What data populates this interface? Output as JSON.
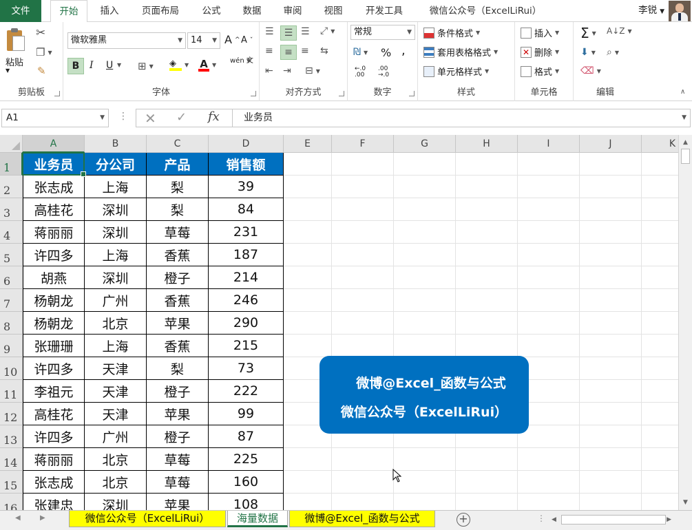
{
  "tabs": {
    "file": "文件",
    "items": [
      "开始",
      "插入",
      "页面布局",
      "公式",
      "数据",
      "审阅",
      "视图",
      "开发工具",
      "微信公众号（ExcelLiRui）"
    ],
    "active": "开始",
    "user": "李锐"
  },
  "ribbon": {
    "clipboard": {
      "paste": "粘贴",
      "label": "剪贴板"
    },
    "font": {
      "name": "微软雅黑",
      "size": "14",
      "bold": "B",
      "italic": "I",
      "underline": "U",
      "grow": "A",
      "shrink": "A",
      "phonetic": "wén 文",
      "label": "字体"
    },
    "alignment": {
      "label": "对齐方式"
    },
    "number": {
      "format": "常规",
      "percent": "%",
      "comma": ",",
      "inc_dec": ".00 .0",
      "label": "数字"
    },
    "styles": {
      "conditional": "条件格式",
      "table": "套用表格格式",
      "cell_styles": "单元格样式",
      "label": "样式"
    },
    "cells": {
      "insert": "插入",
      "delete": "删除",
      "format": "格式",
      "label": "单元格"
    },
    "editing": {
      "sum": "Σ",
      "label": "编辑"
    }
  },
  "formula_bar": {
    "name_box": "A1",
    "fx": "fx",
    "value": "业务员"
  },
  "columns": [
    "A",
    "B",
    "C",
    "D",
    "E",
    "F",
    "G",
    "H",
    "I",
    "J",
    "K"
  ],
  "rows": [
    "1",
    "2",
    "3",
    "4",
    "5",
    "6",
    "7",
    "8",
    "9",
    "10",
    "11",
    "12",
    "13",
    "14",
    "15",
    "16"
  ],
  "table": {
    "headers": [
      "业务员",
      "分公司",
      "产品",
      "销售额"
    ],
    "rows": [
      [
        "张志成",
        "上海",
        "梨",
        "39"
      ],
      [
        "高桂花",
        "深圳",
        "梨",
        "84"
      ],
      [
        "蒋丽丽",
        "深圳",
        "草莓",
        "231"
      ],
      [
        "许四多",
        "上海",
        "香蕉",
        "187"
      ],
      [
        "胡燕",
        "深圳",
        "橙子",
        "214"
      ],
      [
        "杨朝龙",
        "广州",
        "香蕉",
        "246"
      ],
      [
        "杨朝龙",
        "北京",
        "苹果",
        "290"
      ],
      [
        "张珊珊",
        "上海",
        "香蕉",
        "215"
      ],
      [
        "许四多",
        "天津",
        "梨",
        "73"
      ],
      [
        "李祖元",
        "天津",
        "橙子",
        "222"
      ],
      [
        "高桂花",
        "天津",
        "苹果",
        "99"
      ],
      [
        "许四多",
        "广州",
        "橙子",
        "87"
      ],
      [
        "蒋丽丽",
        "北京",
        "草莓",
        "225"
      ],
      [
        "张志成",
        "北京",
        "草莓",
        "160"
      ],
      [
        "张建忠",
        "深圳",
        "苹果",
        "108"
      ]
    ]
  },
  "callout": {
    "line1": "微博@Excel_函数与公式",
    "line2": "微信公众号（ExcelLiRui）"
  },
  "sheet_tabs": [
    "微信公众号（ExcelLiRui）",
    "海量数据",
    "微博@Excel_函数与公式"
  ],
  "active_sheet": "海量数据",
  "colors": {
    "excel_green": "#217346",
    "header_blue": "#0070c0",
    "tab_yellow": "#ffff00"
  }
}
